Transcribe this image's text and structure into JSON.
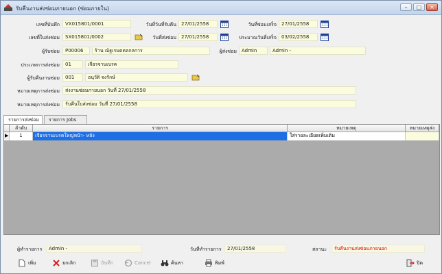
{
  "window": {
    "title": "รับคืนงานส่งซ่อมภายนอก (ซ่อมภายใน)"
  },
  "form": {
    "record_no_label": "เลขที่บันทึก",
    "record_no": "VX015801/0001",
    "receive_date_label": "วันที่วันที่รับคืน",
    "receive_date": "27/01/2558",
    "repair_done_label": "วันที่ซ่อมเสร็จ",
    "repair_done": "27/01/2558",
    "send_no_label": "เลขที่ใบส่งซ่อม",
    "send_no": "SX015801/0002",
    "send_date_label": "วันที่ส่งซ่อม",
    "send_date": "27/01/2558",
    "est_date_label": "ประมาณวันที่เสร็จ",
    "est_date": "03/02/2558",
    "repairer_label": "ผู้รับซ่อม",
    "repairer_code": "P00006",
    "repairer_name": "ร้าน ณัฐเรมดคลกลการ",
    "sender_label": "ผู้ส่งซ่อม",
    "sender_code": "Admin",
    "sender_name": "Admin -",
    "type_label": "ประเภทการส่งซ่อม",
    "type_code": "01",
    "type_name": "เจียรจานเบรค",
    "receiver_label": "ผู้รับคืนงานซ่อม",
    "receiver_code": "001",
    "receiver_name": "อนุวัติ จงรักษ์",
    "note1_label": "หมายเหตุการส่งซ่อม",
    "note1": "ส่งงานซ่อมภายนอก วันที่ 27/01/2558",
    "note2_label": "หมายเหตุการส่งซ่อม",
    "note2": "รับคืนใบส่งซ่อม วันที่ 27/01/2558"
  },
  "tabs": [
    {
      "label": "รายการส่งซ่อม"
    },
    {
      "label": "รายการ Jobs"
    }
  ],
  "grid": {
    "headers": {
      "no": "ลำดับ",
      "item": "รายการ",
      "note": "หมายเหตุ",
      "note2": "หมายเหตุส่ง"
    },
    "rows": [
      {
        "no": "1",
        "item": "เจียรจานเบรคใหญ่หน้า- หลัง",
        "note": "ใส่รายละเอียดเพิ่มเติม"
      }
    ]
  },
  "status": {
    "maker_label": "ผู้ทำรายการ",
    "maker": "Admin -",
    "made_date_label": "วันที่ทำรายการ",
    "made_date": "27/01/2558",
    "state_label": "สถานะ",
    "state": "รับคืนงานส่งซ่อมภายนอก",
    "state_color": "#e00000"
  },
  "toolbar": {
    "add": "เพิ่ม",
    "cancel_doc": "ยกเลิก",
    "save": "บันทึก",
    "cancel": "Cancel",
    "search": "ค้นหา",
    "print": "พิมพ์",
    "close": "ปิด"
  },
  "colors": {
    "selected_row": "#1e6fe6",
    "field_bg": "#fbfbde"
  }
}
